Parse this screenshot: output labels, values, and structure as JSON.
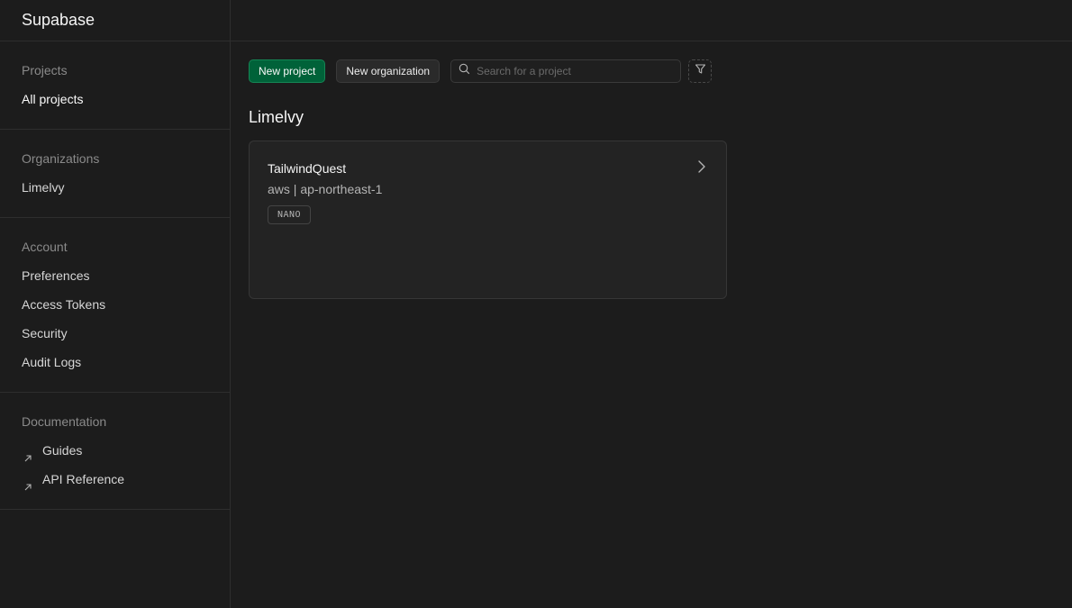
{
  "brand": "Supabase",
  "sidebar": {
    "projects": {
      "heading": "Projects",
      "items": [
        {
          "label": "All projects"
        }
      ]
    },
    "organizations": {
      "heading": "Organizations",
      "items": [
        {
          "label": "Limelvy"
        }
      ]
    },
    "account": {
      "heading": "Account",
      "items": [
        {
          "label": "Preferences"
        },
        {
          "label": "Access Tokens"
        },
        {
          "label": "Security"
        },
        {
          "label": "Audit Logs"
        }
      ]
    },
    "documentation": {
      "heading": "Documentation",
      "items": [
        {
          "label": "Guides",
          "icon": "external-link-icon"
        },
        {
          "label": "API Reference",
          "icon": "external-link-icon"
        }
      ]
    }
  },
  "toolbar": {
    "new_project_label": "New project",
    "new_organization_label": "New organization",
    "search_placeholder": "Search for a project",
    "search_icon": "search-icon",
    "filter_icon": "filter-icon"
  },
  "organization": {
    "name": "Limelvy",
    "projects": [
      {
        "name": "TailwindQuest",
        "region": "aws | ap-northeast-1",
        "badge": "NANO"
      }
    ]
  },
  "colors": {
    "background": "#1c1c1c",
    "primary": "#006239",
    "card": "#232323",
    "border": "#2e2e2e"
  }
}
